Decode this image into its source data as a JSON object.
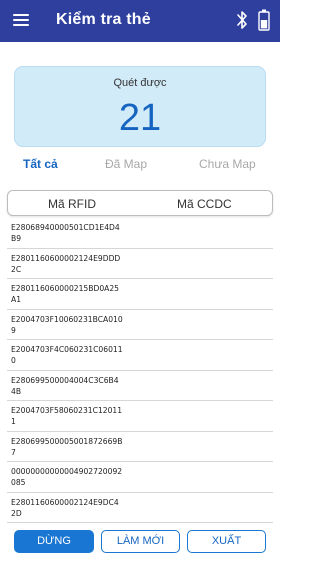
{
  "appbar": {
    "title": "Kiểm tra thẻ",
    "menu_icon": "hamburger-menu-icon",
    "bluetooth_icon": "bluetooth-icon",
    "battery_icon": "battery-icon",
    "bar_color": "#2f3f9e"
  },
  "scan": {
    "label": "Quét được",
    "count": "21",
    "card_color": "#d2ebf9",
    "count_color": "#1565c0"
  },
  "tabs": [
    {
      "label": "Tất cả",
      "active": true
    },
    {
      "label": "Đã Map",
      "active": false
    },
    {
      "label": "Chưa Map",
      "active": false
    }
  ],
  "table": {
    "headers": [
      "Mã RFID",
      "Mã CCDC"
    ],
    "rows": [
      {
        "rfid": "E28068940000501CD1E4D4B9",
        "ccdc": ""
      },
      {
        "rfid": "E2801160600002124E9DDD2C",
        "ccdc": ""
      },
      {
        "rfid": "E280116060000215BD0A25A1",
        "ccdc": ""
      },
      {
        "rfid": "E2004703F10060231BCA0109",
        "ccdc": ""
      },
      {
        "rfid": "E2004703F4C060231C060110",
        "ccdc": ""
      },
      {
        "rfid": "E280699500004004C3C6B44B",
        "ccdc": ""
      },
      {
        "rfid": "E2004703F58060231C120111",
        "ccdc": ""
      },
      {
        "rfid": "E280699500005001872669B7",
        "ccdc": ""
      },
      {
        "rfid": "00000000000004902720092085",
        "ccdc": ""
      },
      {
        "rfid": "E2801160600002124E9DC42D",
        "ccdc": ""
      }
    ]
  },
  "buttons": {
    "stop": "DỪNG",
    "refresh": "LÀM MỚI",
    "export": "XUẤT",
    "accent_color": "#1976d2"
  }
}
